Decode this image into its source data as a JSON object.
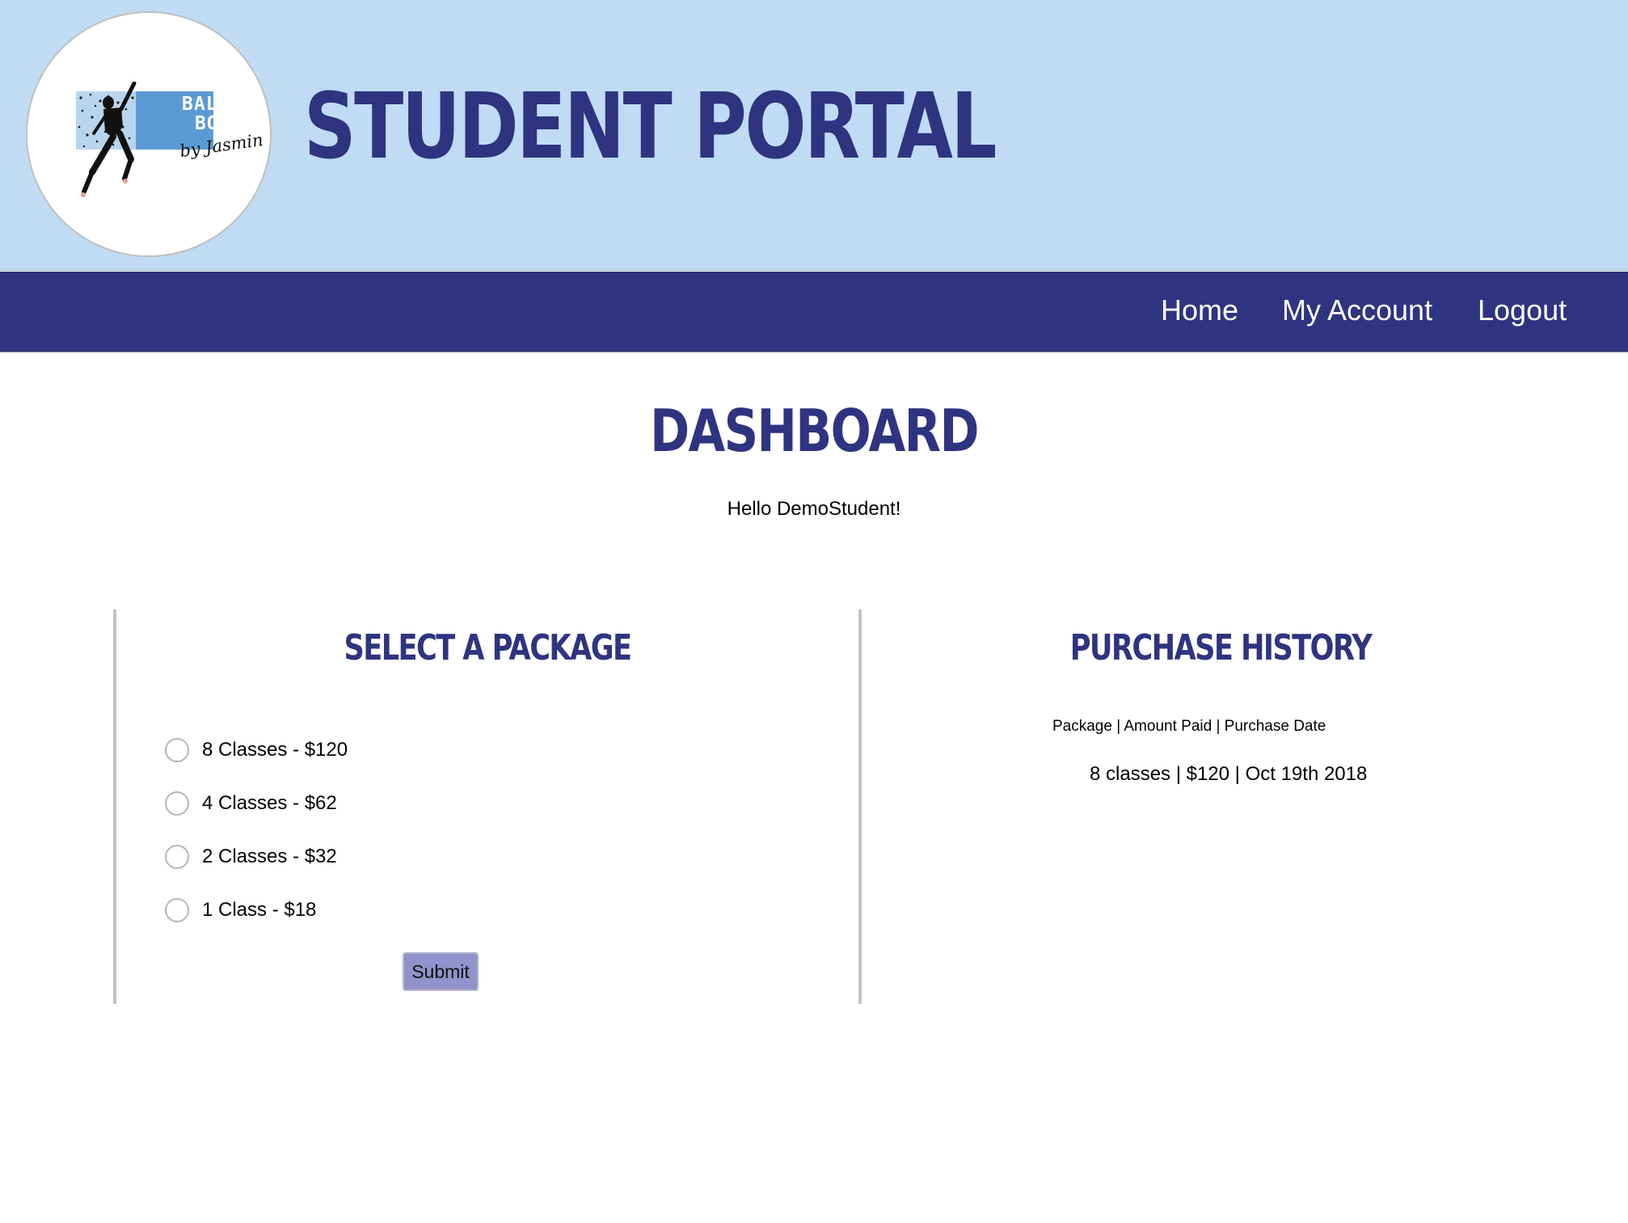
{
  "header": {
    "logo": {
      "line1": "BALLET",
      "line2": "BODY",
      "script": "by Jasmin"
    },
    "title": "STUDENT PORTAL"
  },
  "nav": {
    "items": [
      {
        "label": "Home"
      },
      {
        "label": "My Account"
      },
      {
        "label": "Logout"
      }
    ]
  },
  "main": {
    "title": "DASHBOARD",
    "greeting": "Hello DemoStudent!"
  },
  "packages": {
    "title": "SELECT A PACKAGE",
    "options": [
      {
        "label": "8 Classes - $120",
        "selected": false
      },
      {
        "label": "4 Classes - $62",
        "selected": false
      },
      {
        "label": "2 Classes - $32",
        "selected": false
      },
      {
        "label": "1 Class - $18",
        "selected": false
      }
    ],
    "submit_label": "Submit"
  },
  "history": {
    "title": "PURCHASE HISTORY",
    "header": "Package | Amount Paid | Purchase Date",
    "rows": [
      {
        "text": "8 classes | $120 | Oct 19th 2018"
      }
    ]
  },
  "colors": {
    "header_bg": "#c0dbf3",
    "nav_bg": "#2e3480",
    "accent": "#2e3480",
    "button_bg": "#9292cc",
    "logo_blue": "#5b9bd5"
  },
  "icons": {
    "logo": "ballet-dancer-logo"
  }
}
